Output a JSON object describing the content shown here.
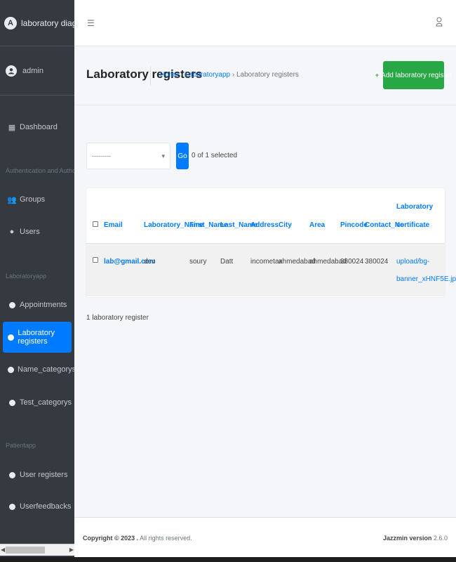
{
  "brand": {
    "logo_letter": "A",
    "name": "laboratory diagnosis sy"
  },
  "user": {
    "name": "admin"
  },
  "sidebar": {
    "dashboard": "Dashboard",
    "section_auth": "Authentication and Authorization",
    "groups": "Groups",
    "users": "Users",
    "section_lab": "Laboratoryapp",
    "appointments": "Appointments",
    "lab_registers": "Laboratory registers",
    "name_categorys": "Name_categorys",
    "test_categorys": "Test_categorys",
    "section_patient": "Patientapp",
    "user_registers": "User registers",
    "userfeedbacks": "Userfeedbacks"
  },
  "header": {
    "title": "Laboratory registers",
    "breadcrumb": {
      "home": "Home",
      "sep1": "›",
      "app": "Laboratoryapp",
      "sep2": "›",
      "current": "Laboratory registers"
    },
    "add_button": "Add laboratory register"
  },
  "actions": {
    "select_value": "---------",
    "go_label": "Go",
    "selected_text": "0 of 1 selected"
  },
  "table": {
    "columns": {
      "email": "Email",
      "lab_name": "Laboratory_Name",
      "first_name": "First_Name",
      "last_name": "Last_Name",
      "address": "Address",
      "city": "City",
      "area": "Area",
      "pincode": "Pincode",
      "contact": "Contact_No",
      "certificate_1": "Laboratory",
      "certificate_2": "certificate"
    },
    "row": {
      "email": "lab@gmail.com",
      "lab_name": "dev",
      "first_name": "soury",
      "last_name": "Datt",
      "address": "incometax",
      "city": "ahmedabad",
      "area": "ahmedabad",
      "pincode": "380024",
      "contact": "380024",
      "certificate_1": "upload/bg-",
      "certificate_2": "banner_xHNF5E.jpg"
    }
  },
  "result_count": "1 laboratory register",
  "footer": {
    "copyright_bold": "Copyright © 2023 .",
    "copyright_rest": " All rights reserved.",
    "version_bold": "Jazzmin version",
    "version_num": " 2.6.0"
  },
  "colors": {
    "primary": "#007bff",
    "success": "#28a745",
    "sidebar": "#343a40"
  }
}
